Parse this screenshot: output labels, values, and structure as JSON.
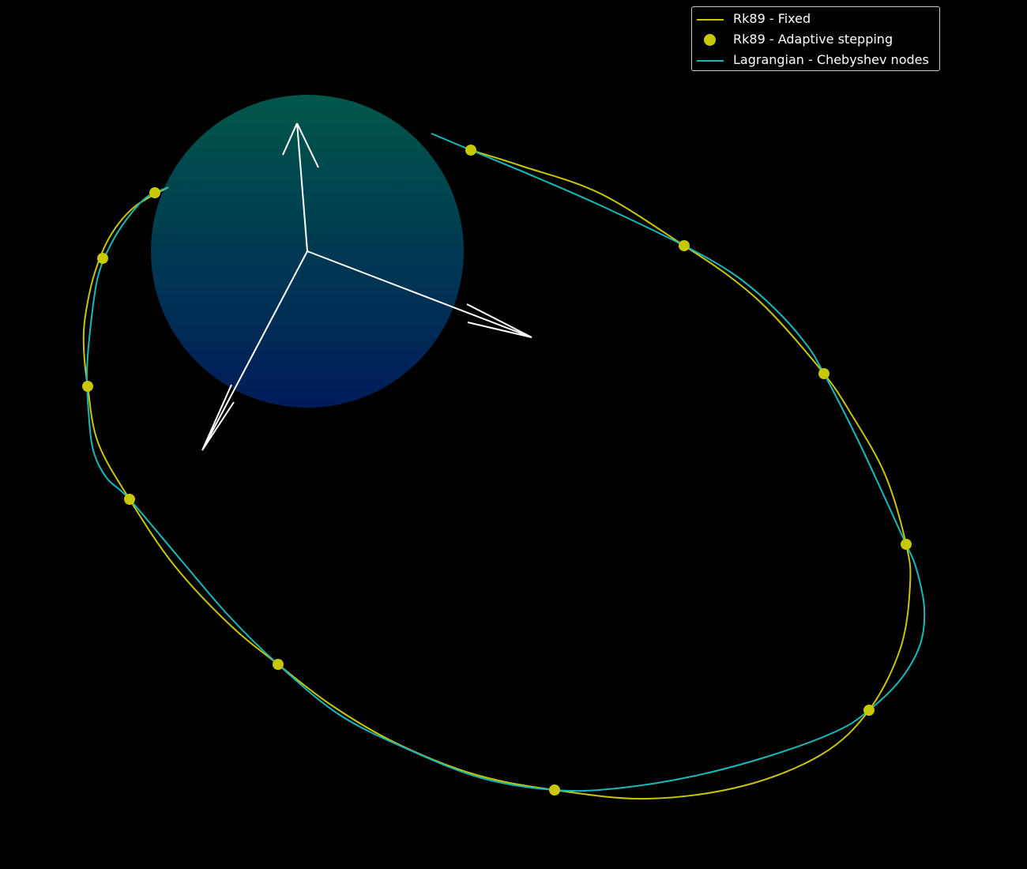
{
  "chart_data": {
    "type": "line",
    "title": "",
    "background": "#000000",
    "legend_placement": "top-right",
    "grid": false,
    "axes_visible": false,
    "series": [
      {
        "name": "Rk89 - Fixed",
        "style": "line",
        "color": "#c8c800",
        "points": [
          [
            213,
            237
          ],
          [
            170,
            262
          ],
          [
            140,
            298
          ],
          [
            120,
            345
          ],
          [
            108,
            400
          ],
          [
            106,
            440
          ],
          [
            111,
            489
          ],
          [
            124,
            560
          ],
          [
            164,
            632
          ],
          [
            220,
            715
          ],
          [
            290,
            790
          ],
          [
            352,
            841
          ],
          [
            420,
            893
          ],
          [
            500,
            940
          ],
          [
            600,
            980
          ],
          [
            702,
            1000
          ],
          [
            820,
            1011
          ],
          [
            940,
            995
          ],
          [
            1040,
            955
          ],
          [
            1100,
            899
          ],
          [
            1140,
            820
          ],
          [
            1152,
            740
          ],
          [
            1147,
            689
          ],
          [
            1120,
            600
          ],
          [
            1075,
            520
          ],
          [
            1043,
            473
          ],
          [
            980,
            400
          ],
          [
            930,
            355
          ],
          [
            866,
            311
          ],
          [
            760,
            245
          ],
          [
            660,
            210
          ],
          [
            596,
            190
          ]
        ]
      },
      {
        "name": "Rk89 - Adaptive stepping",
        "style": "marker",
        "color": "#c8c800",
        "points": [
          [
            196,
            244
          ],
          [
            130,
            327
          ],
          [
            111,
            489
          ],
          [
            164,
            632
          ],
          [
            352,
            841
          ],
          [
            702,
            1000
          ],
          [
            1100,
            899
          ],
          [
            1147,
            689
          ],
          [
            1043,
            473
          ],
          [
            866,
            311
          ],
          [
            596,
            190
          ]
        ]
      },
      {
        "name": "Lagrangian - Chebyshev nodes",
        "style": "line",
        "color": "#17b9b9",
        "points": [
          [
            213,
            237
          ],
          [
            185,
            250
          ],
          [
            160,
            278
          ],
          [
            140,
            310
          ],
          [
            124,
            350
          ],
          [
            115,
            410
          ],
          [
            110,
            470
          ],
          [
            112,
            520
          ],
          [
            118,
            570
          ],
          [
            135,
            605
          ],
          [
            164,
            632
          ],
          [
            230,
            710
          ],
          [
            290,
            780
          ],
          [
            352,
            841
          ],
          [
            430,
            905
          ],
          [
            520,
            950
          ],
          [
            610,
            985
          ],
          [
            702,
            1000
          ],
          [
            780,
            998
          ],
          [
            880,
            982
          ],
          [
            980,
            955
          ],
          [
            1060,
            925
          ],
          [
            1100,
            899
          ],
          [
            1140,
            860
          ],
          [
            1165,
            815
          ],
          [
            1170,
            770
          ],
          [
            1160,
            720
          ],
          [
            1147,
            689
          ],
          [
            1120,
            630
          ],
          [
            1085,
            555
          ],
          [
            1043,
            473
          ],
          [
            1020,
            435
          ],
          [
            980,
            390
          ],
          [
            930,
            348
          ],
          [
            866,
            311
          ],
          [
            760,
            260
          ],
          [
            680,
            225
          ],
          [
            596,
            190
          ],
          [
            546,
            169
          ]
        ]
      }
    ],
    "sphere": {
      "color_top": "#00574a",
      "color_bottom": "#001c5a"
    },
    "axes_arrows_color": "#ffffff"
  },
  "legend": {
    "items": [
      {
        "label": "Rk89 - Fixed",
        "color": "#c8c800",
        "kind": "line"
      },
      {
        "label": "Rk89 - Adaptive stepping",
        "color": "#c8c800",
        "kind": "dot"
      },
      {
        "label": "Lagrangian - Chebyshev nodes",
        "color": "#17b9b9",
        "kind": "line"
      }
    ]
  }
}
